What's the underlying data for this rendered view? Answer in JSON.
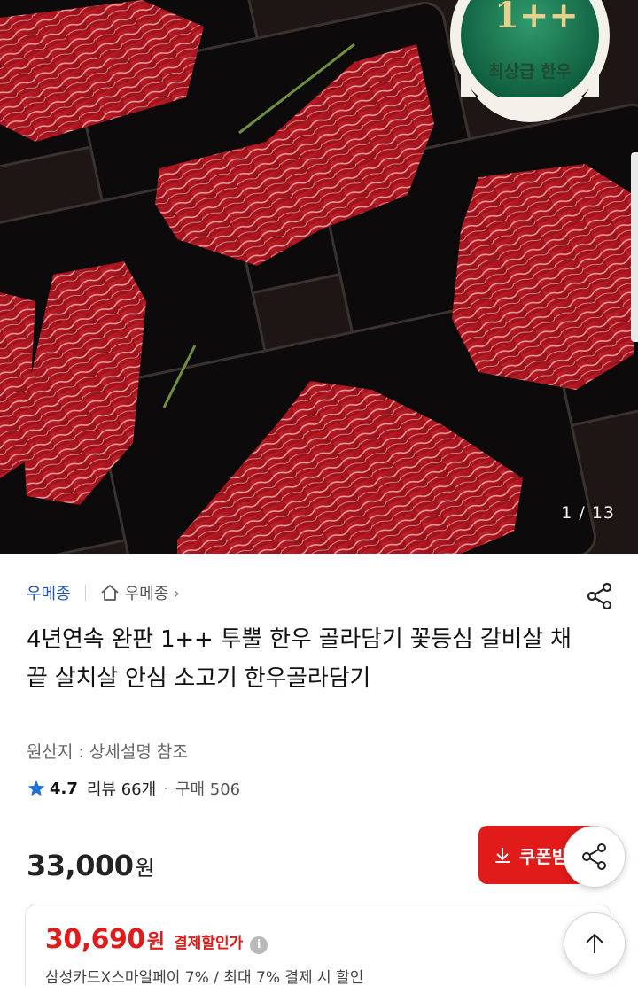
{
  "gallery": {
    "badge_grade": "1++",
    "badge_text": "최상급 한우",
    "counter": "1 / 13"
  },
  "seller": {
    "name": "우메종",
    "store_name": "우메종",
    "store_chevron": "›"
  },
  "product": {
    "title": "4년연속 완판 1++ 투뿔 한우 골라담기 꽃등심 갈비살 채끝 살치살 안심 소고기 한우골라담기",
    "origin": "원산지 : 상세설명 참조",
    "rating": "4.7",
    "reviews": "리뷰 66개",
    "purchases": "구매 506",
    "price": "33,000",
    "currency": "원"
  },
  "coupon": {
    "label": "쿠폰받"
  },
  "payment": {
    "price": "30,690",
    "currency": "원",
    "label": "결제할인가",
    "info": "i",
    "description": "삼성카드X스마일페이 7% / 최대 7% 결제 시 할인"
  },
  "icons": {
    "share": "share-icon",
    "home": "home-icon",
    "star": "star-icon",
    "download": "download-icon",
    "arrow_up": "arrow-up-icon"
  },
  "colors": {
    "accent_red": "#e11a1a",
    "link_blue": "#2453b8",
    "star_blue": "#1f6fd6"
  }
}
